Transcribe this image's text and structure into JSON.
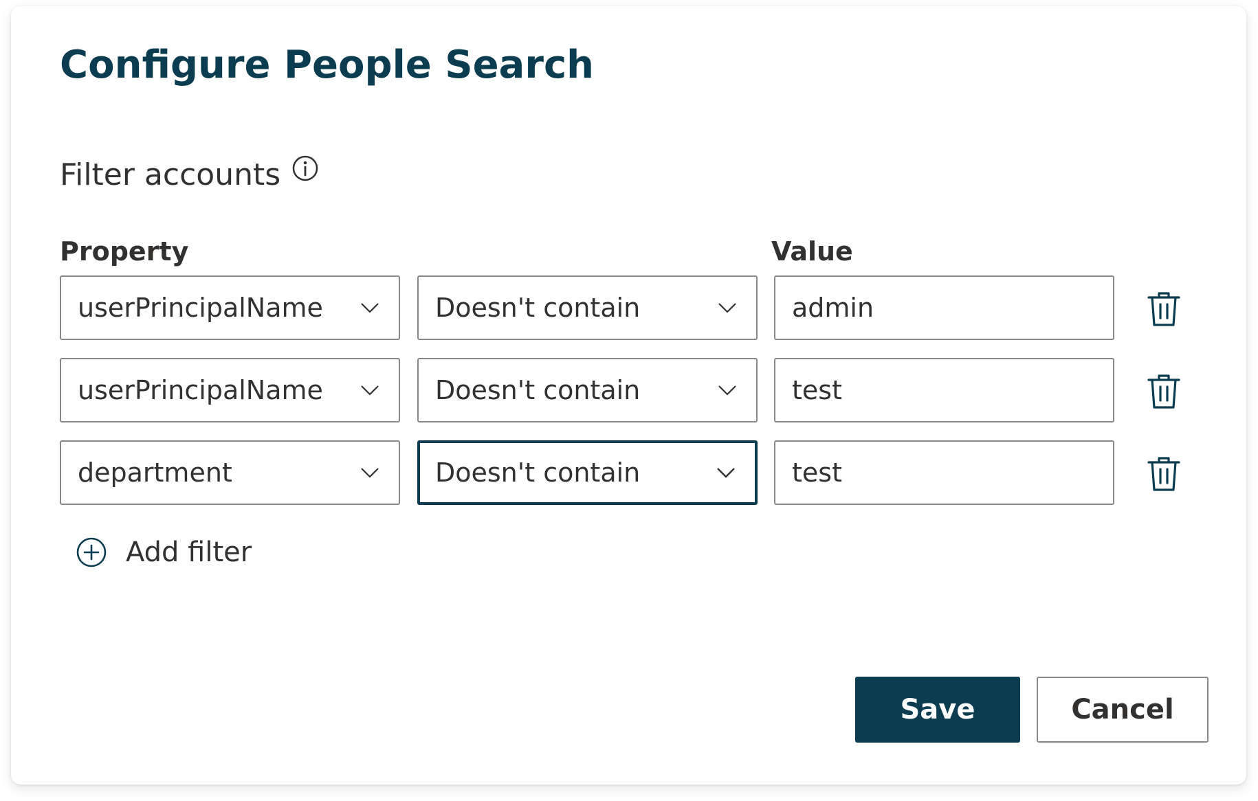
{
  "dialog": {
    "title": "Configure People Search",
    "section_label": "Filter accounts",
    "property_header": "Property",
    "value_header": "Value",
    "filters": [
      {
        "property": "userPrincipalName",
        "operator": "Doesn't contain",
        "value": "admin"
      },
      {
        "property": "userPrincipalName",
        "operator": "Doesn't contain",
        "value": "test"
      },
      {
        "property": "department",
        "operator": "Doesn't contain",
        "value": "test"
      }
    ],
    "add_filter_label": "Add filter",
    "save_label": "Save",
    "cancel_label": "Cancel"
  },
  "icons": {
    "info": "info-icon",
    "chevron": "chevron-down-icon",
    "delete": "trash-icon",
    "add": "plus-circle-icon"
  },
  "colors": {
    "accent": "#0b3c50",
    "text": "#323130",
    "border": "#8a8886"
  }
}
